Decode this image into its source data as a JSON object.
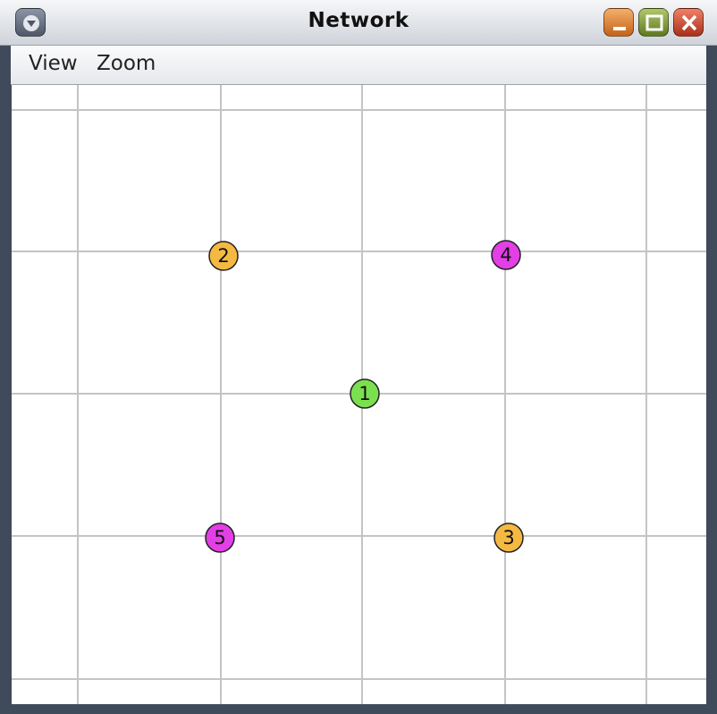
{
  "window": {
    "title": "Network"
  },
  "titlebar": {
    "buttons": [
      "window-menu",
      "minimize",
      "maximize",
      "close"
    ]
  },
  "menubar": {
    "items": [
      {
        "label": "View"
      },
      {
        "label": "Zoom"
      }
    ]
  },
  "graph": {
    "nodes": [
      {
        "id": "1",
        "color": "#7be04f"
      },
      {
        "id": "2",
        "color": "#f4b942"
      },
      {
        "id": "3",
        "color": "#f4b942"
      },
      {
        "id": "4",
        "color": "#e23fe6"
      },
      {
        "id": "5",
        "color": "#e23fe6"
      }
    ]
  },
  "colors": {
    "grid": "#c4c4c4",
    "node_green": "#7be04f",
    "node_orange": "#f4b942",
    "node_magenta": "#e23fe6",
    "frame": "#3f4a5a"
  }
}
